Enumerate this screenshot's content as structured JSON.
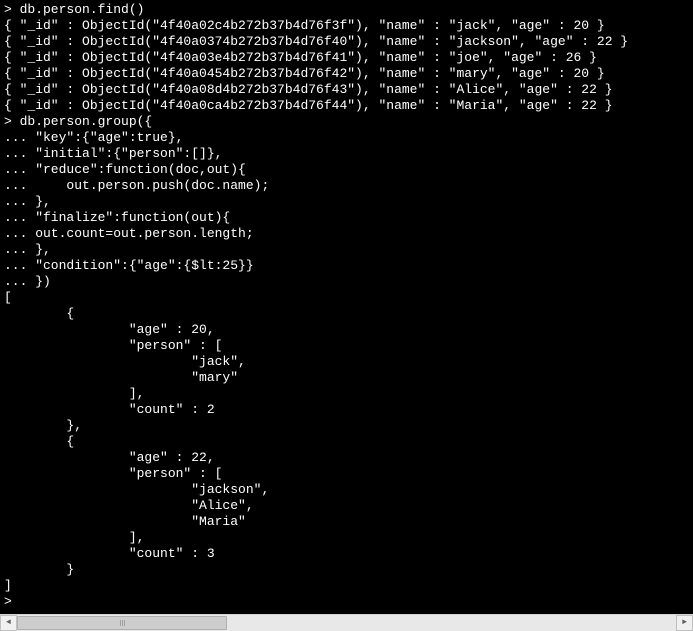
{
  "terminal": {
    "lines": [
      "> db.person.find()",
      "{ \"_id\" : ObjectId(\"4f40a02c4b272b37b4d76f3f\"), \"name\" : \"jack\", \"age\" : 20 }",
      "{ \"_id\" : ObjectId(\"4f40a0374b272b37b4d76f40\"), \"name\" : \"jackson\", \"age\" : 22 }",
      "{ \"_id\" : ObjectId(\"4f40a03e4b272b37b4d76f41\"), \"name\" : \"joe\", \"age\" : 26 }",
      "{ \"_id\" : ObjectId(\"4f40a0454b272b37b4d76f42\"), \"name\" : \"mary\", \"age\" : 20 }",
      "{ \"_id\" : ObjectId(\"4f40a08d4b272b37b4d76f43\"), \"name\" : \"Alice\", \"age\" : 22 }",
      "{ \"_id\" : ObjectId(\"4f40a0ca4b272b37b4d76f44\"), \"name\" : \"Maria\", \"age\" : 22 }",
      "> db.person.group({",
      "... \"key\":{\"age\":true},",
      "... \"initial\":{\"person\":[]},",
      "... \"reduce\":function(doc,out){",
      "...     out.person.push(doc.name);",
      "... },",
      "... \"finalize\":function(out){",
      "... out.count=out.person.length;",
      "... },",
      "... \"condition\":{\"age\":{$lt:25}}",
      "... })",
      "[",
      "        {",
      "                \"age\" : 20,",
      "                \"person\" : [",
      "                        \"jack\",",
      "                        \"mary\"",
      "                ],",
      "                \"count\" : 2",
      "        },",
      "        {",
      "                \"age\" : 22,",
      "                \"person\" : [",
      "                        \"jackson\",",
      "                        \"Alice\",",
      "                        \"Maria\"",
      "                ],",
      "                \"count\" : 3",
      "        }",
      "]",
      "> "
    ]
  },
  "scrollbar": {
    "left_arrow": "◄",
    "right_arrow": "►"
  }
}
